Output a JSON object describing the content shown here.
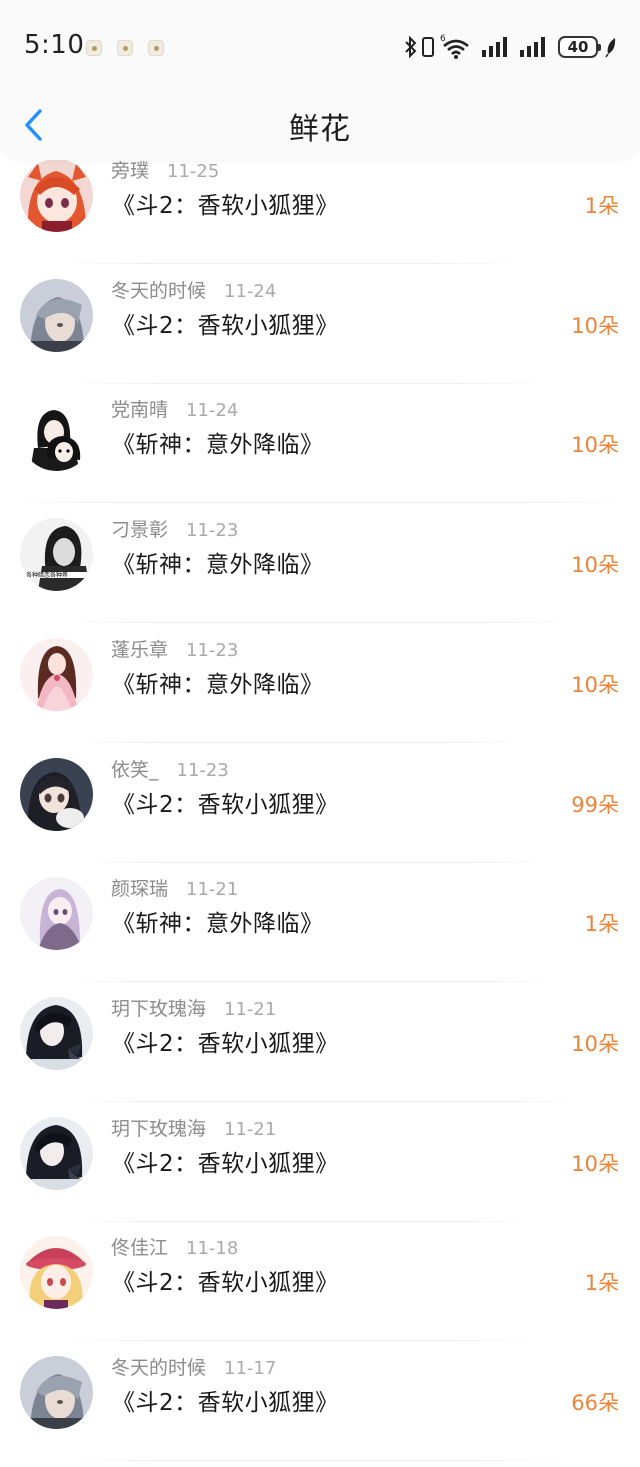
{
  "status_bar": {
    "time": "5:10",
    "battery": "40",
    "icons": [
      "bluetooth-icon",
      "phone-icon",
      "wifi-icon",
      "signal-icon",
      "signal-icon",
      "leaf-icon"
    ]
  },
  "header": {
    "title": "鲜花",
    "back_icon": "chevron-left-icon"
  },
  "colors": {
    "accent": "#1e90ff",
    "count": "#f0833a",
    "meta": "#8c8c8c"
  },
  "records": [
    {
      "user": "旁璞",
      "date": "11-25",
      "book": "《斗2：香软小狐狸》",
      "count": "1朵",
      "avatar": "anime-girl-red"
    },
    {
      "user": "冬天的时候",
      "date": "11-24",
      "book": "《斗2：香软小狐狸》",
      "count": "10朵",
      "avatar": "boy-grey-hair"
    },
    {
      "user": "党南晴",
      "date": "11-24",
      "book": "《斩神：意外降临》",
      "count": "10朵",
      "avatar": "couple-black"
    },
    {
      "user": "刁景彰",
      "date": "11-23",
      "book": "《斩神：意外降临》",
      "count": "10朵",
      "avatar": "boy-monochrome"
    },
    {
      "user": "蓬乐章",
      "date": "11-23",
      "book": "《斩神：意外降临》",
      "count": "10朵",
      "avatar": "girl-pink-dress"
    },
    {
      "user": "依笑_",
      "date": "11-23",
      "book": "《斗2：香软小狐狸》",
      "count": "99朵",
      "avatar": "girl-with-cat"
    },
    {
      "user": "颜琛瑞",
      "date": "11-21",
      "book": "《斩神：意外降临》",
      "count": "1朵",
      "avatar": "girl-pale-purple"
    },
    {
      "user": "玥下玫瑰海",
      "date": "11-21",
      "book": "《斗2：香软小狐狸》",
      "count": "10朵",
      "avatar": "girl-butterfly"
    },
    {
      "user": "玥下玫瑰海",
      "date": "11-21",
      "book": "《斗2：香软小狐狸》",
      "count": "10朵",
      "avatar": "girl-butterfly"
    },
    {
      "user": "佟佳江",
      "date": "11-18",
      "book": "《斗2：香软小狐狸》",
      "count": "1朵",
      "avatar": "girl-blonde-hat"
    },
    {
      "user": "冬天的时候",
      "date": "11-17",
      "book": "《斗2：香软小狐狸》",
      "count": "66朵",
      "avatar": "boy-grey-hair"
    }
  ]
}
